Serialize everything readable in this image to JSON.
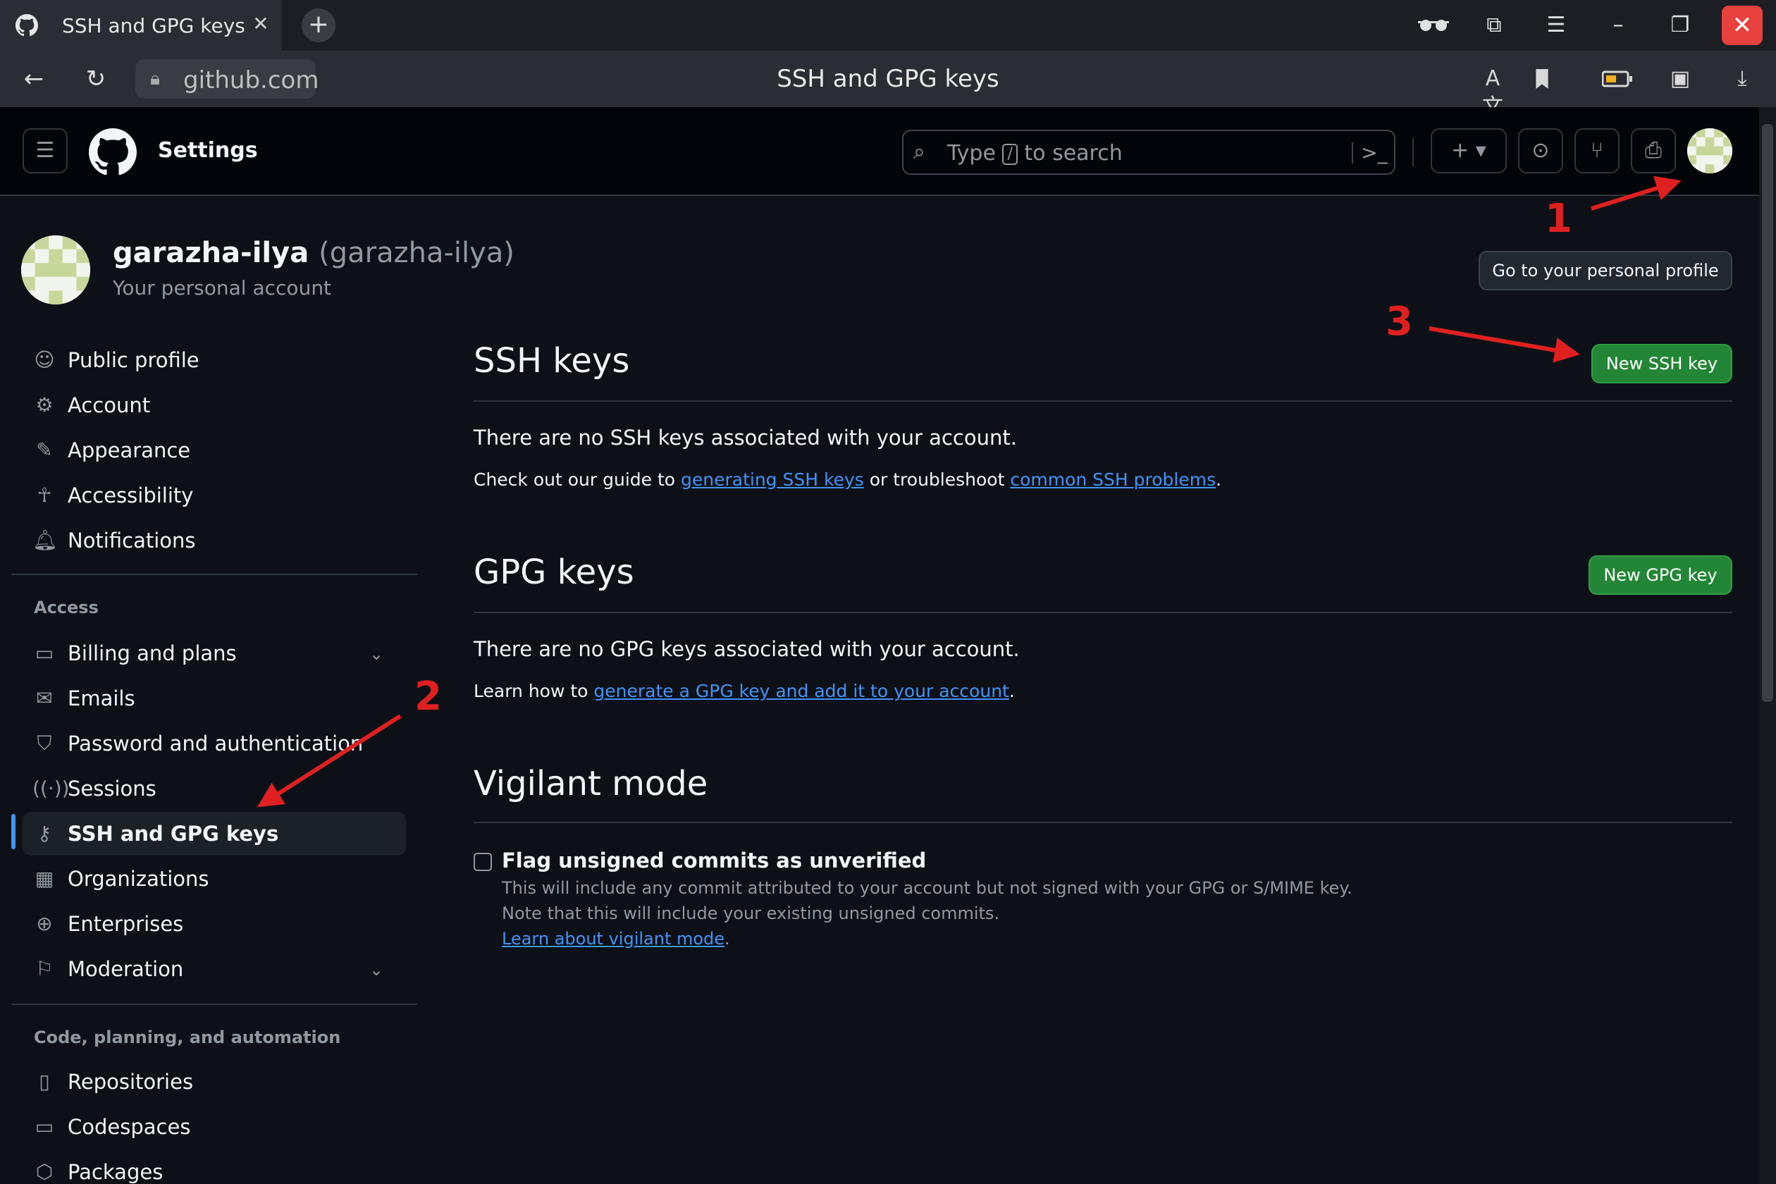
{
  "browser": {
    "tab_title": "SSH and GPG keys",
    "url": "github.com",
    "page_title": "SSH and GPG keys"
  },
  "header": {
    "context": "Settings",
    "search_prefix": "Type",
    "search_key": "/",
    "search_suffix": "to search"
  },
  "account": {
    "name": "garazha-ilya",
    "handle": "(garazha-ilya)",
    "subtitle": "Your personal account",
    "profile_button": "Go to your personal profile"
  },
  "sidebar": {
    "items_top": [
      {
        "label": "Public profile",
        "icon": "person-icon"
      },
      {
        "label": "Account",
        "icon": "gear-icon"
      },
      {
        "label": "Appearance",
        "icon": "paintbrush-icon"
      },
      {
        "label": "Accessibility",
        "icon": "accessibility-icon"
      },
      {
        "label": "Notifications",
        "icon": "bell-icon"
      }
    ],
    "access_heading": "Access",
    "items_access": [
      {
        "label": "Billing and plans",
        "icon": "credit-card-icon"
      },
      {
        "label": "Emails",
        "icon": "mail-icon"
      },
      {
        "label": "Password and authentication",
        "icon": "shield-icon"
      },
      {
        "label": "Sessions",
        "icon": "broadcast-icon"
      },
      {
        "label": "SSH and GPG keys",
        "icon": "key-icon"
      },
      {
        "label": "Organizations",
        "icon": "organization-icon"
      },
      {
        "label": "Enterprises",
        "icon": "globe-icon"
      },
      {
        "label": "Moderation",
        "icon": "report-icon"
      }
    ],
    "code_heading": "Code, planning, and automation",
    "items_code": [
      {
        "label": "Repositories",
        "icon": "repo-icon"
      },
      {
        "label": "Codespaces",
        "icon": "codespaces-icon"
      },
      {
        "label": "Packages",
        "icon": "package-icon"
      }
    ]
  },
  "ssh": {
    "title": "SSH keys",
    "button": "New SSH key",
    "empty": "There are no SSH keys associated with your account.",
    "guide_prefix": "Check out our guide to",
    "guide_link1": "generating SSH keys",
    "guide_middle": "or troubleshoot",
    "guide_link2": "common SSH problems",
    "guide_suffix": "."
  },
  "gpg": {
    "title": "GPG keys",
    "button": "New GPG key",
    "empty": "There are no GPG keys associated with your account.",
    "learn_prefix": "Learn how to",
    "learn_link": "generate a GPG key and add it to your account",
    "learn_suffix": "."
  },
  "vigilant": {
    "title": "Vigilant mode",
    "checkbox_label": "Flag unsigned commits as unverified",
    "note1": "This will include any commit attributed to your account but not signed with your GPG or S/MIME key.",
    "note2": "Note that this will include your existing unsigned commits.",
    "learn_link": "Learn about vigilant mode",
    "learn_suffix": ".",
    "checked": false
  },
  "annotations": {
    "one": "1",
    "two": "2",
    "three": "3",
    "color": "#e02020"
  },
  "colors": {
    "accent_blue": "#4493f8",
    "green_button": "#238636",
    "background": "#0d1117"
  }
}
